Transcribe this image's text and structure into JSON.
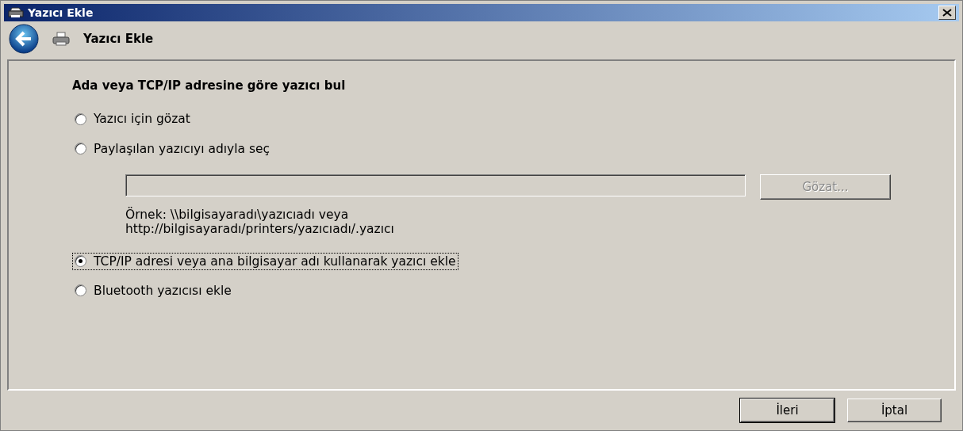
{
  "window": {
    "title": "Yazıcı Ekle"
  },
  "header": {
    "title": "Yazıcı Ekle"
  },
  "heading": "Ada veya TCP/IP adresine göre yazıcı bul",
  "options": [
    {
      "label": "Yazıcı için gözat",
      "selected": false,
      "focused": false
    },
    {
      "label": "Paylaşılan yazıcıyı adıyla seç",
      "selected": false,
      "focused": false,
      "share": {
        "browse_button": {
          "label": "Gözat...",
          "disabled": true
        },
        "example_lines": [
          "Örnek: \\\\bilgisayaradı\\yazıcıadı veya",
          "http://bilgisayaradı/printers/yazıcıadı/.yazıcı"
        ]
      }
    },
    {
      "label": "TCP/IP adresi veya ana bilgisayar adı kullanarak yazıcı ekle",
      "selected": true,
      "focused": true
    },
    {
      "label": "Bluetooth yazıcısı ekle",
      "selected": false,
      "focused": false
    }
  ],
  "buttons": [
    {
      "label": "İleri",
      "default": true
    },
    {
      "label": "İptal",
      "default": false
    }
  ]
}
